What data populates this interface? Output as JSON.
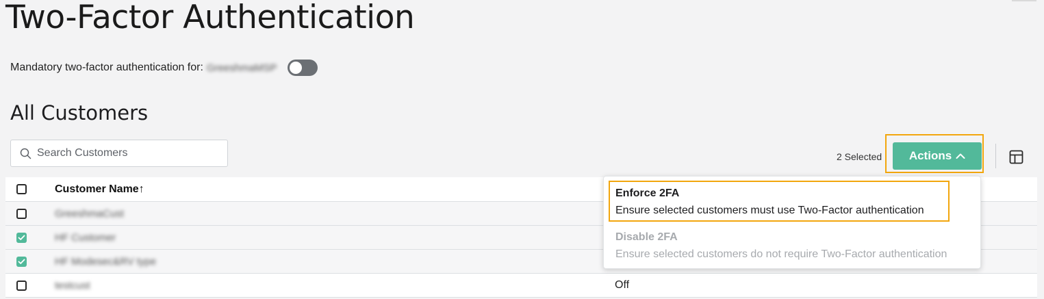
{
  "page": {
    "title": "Two-Factor Authentication"
  },
  "mandatory": {
    "label": "Mandatory two-factor authentication for:",
    "org_name": "GreeshmaMSP",
    "toggle_on": false
  },
  "section": {
    "title": "All Customers"
  },
  "search": {
    "placeholder": "Search Customers",
    "value": ""
  },
  "toolbar": {
    "selected_count": "2 Selected",
    "actions_label": "Actions"
  },
  "table": {
    "columns": {
      "name": "Customer Name",
      "sort_indicator": "↑"
    },
    "rows": [
      {
        "name": "GreeshmaCust",
        "status": "",
        "checked": false
      },
      {
        "name": "HF Customer",
        "status": "",
        "checked": true
      },
      {
        "name": "HF Modesec&RV type",
        "status": "",
        "checked": true
      },
      {
        "name": "testcust",
        "status": "Off",
        "checked": false
      }
    ]
  },
  "actions_menu": {
    "items": [
      {
        "title": "Enforce 2FA",
        "description": "Ensure selected customers must use Two-Factor authentication",
        "enabled": true
      },
      {
        "title": "Disable 2FA",
        "description": "Ensure selected customers do not require Two-Factor authentication",
        "enabled": false
      }
    ]
  },
  "colors": {
    "accent": "#52b99a",
    "highlight": "#f2a60d",
    "toggle_off": "#6b6f74"
  }
}
